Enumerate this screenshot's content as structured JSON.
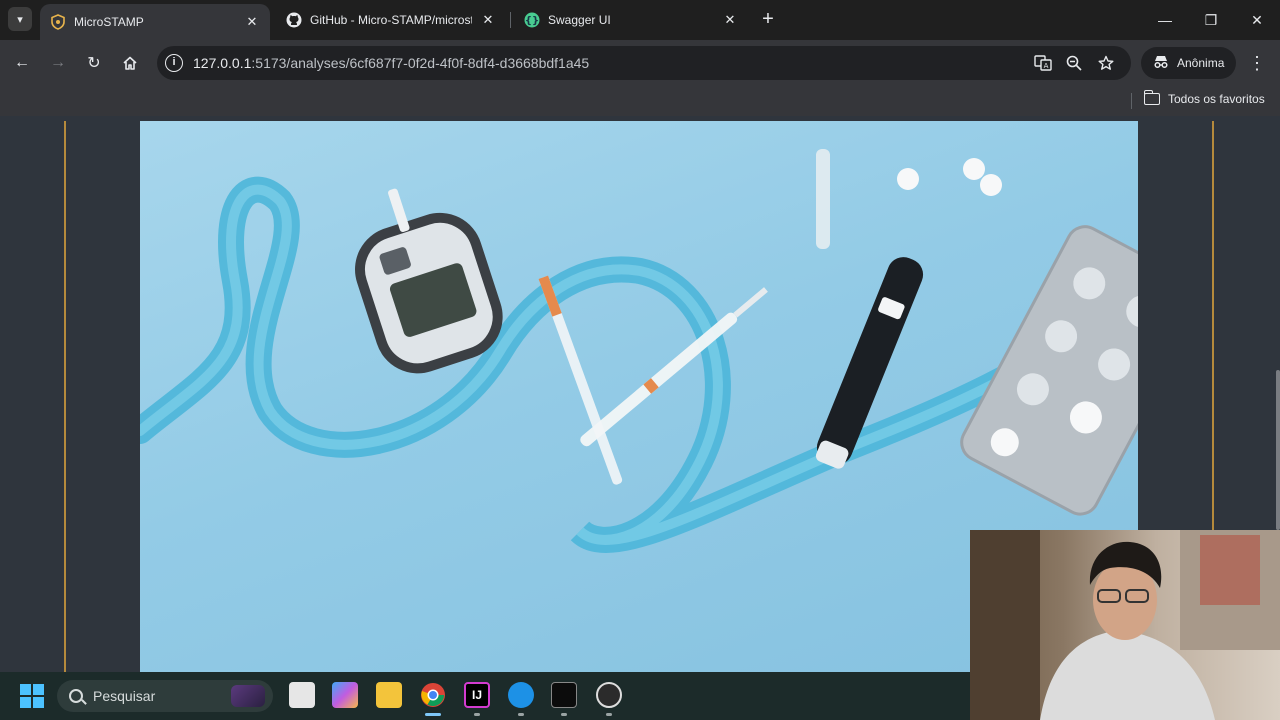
{
  "browser": {
    "tabs": [
      {
        "title": "MicroSTAMP",
        "icon": "shield-icon",
        "active": true
      },
      {
        "title": "GitHub - Micro-STAMP/microst",
        "icon": "github-icon",
        "active": false
      },
      {
        "title": "Swagger UI",
        "icon": "swagger-icon",
        "active": false
      }
    ],
    "close_glyph": "✕",
    "new_tab_glyph": "+",
    "window_controls": {
      "minimize": "—",
      "restore": "❐",
      "close": "✕"
    },
    "address": {
      "host": "127.0.0.1",
      "rest": ":5173/analyses/6cf687f7-0f2d-4f0f-8df4-d3668bdf1a45"
    },
    "profile_label": "Anônima",
    "bookmarks_all_label": "Todos os favoritos"
  },
  "page": {
    "hero_image": "diabetes-supplies-photo",
    "accent_color": "#b58a3c",
    "background_color": "#2f353d"
  },
  "taskbar": {
    "search_placeholder": "Pesquisar",
    "apps": [
      "task-view",
      "copilot",
      "file-explorer",
      "chrome",
      "intellij",
      "docker",
      "terminal",
      "obs"
    ]
  }
}
